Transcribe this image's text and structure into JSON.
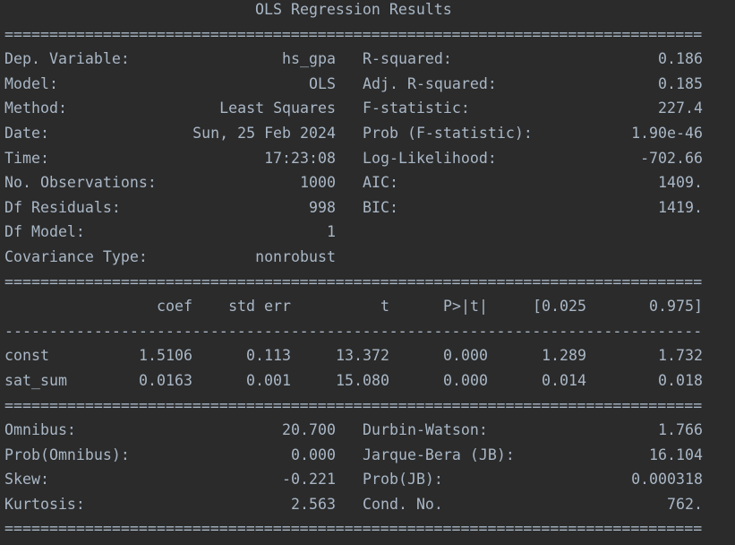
{
  "title": "OLS Regression Results",
  "sep_eq": "==============================================================================",
  "sep_dash": "------------------------------------------------------------------------------",
  "summary": [
    {
      "l_label": "Dep. Variable:",
      "l_value": "hs_gpa",
      "r_label": "R-squared:",
      "r_value": "0.186"
    },
    {
      "l_label": "Model:",
      "l_value": "OLS",
      "r_label": "Adj. R-squared:",
      "r_value": "0.185"
    },
    {
      "l_label": "Method:",
      "l_value": "Least Squares",
      "r_label": "F-statistic:",
      "r_value": "227.4"
    },
    {
      "l_label": "Date:",
      "l_value": "Sun, 25 Feb 2024",
      "r_label": "Prob (F-statistic):",
      "r_value": "1.90e-46"
    },
    {
      "l_label": "Time:",
      "l_value": "17:23:08",
      "r_label": "Log-Likelihood:",
      "r_value": "-702.66"
    },
    {
      "l_label": "No. Observations:",
      "l_value": "1000",
      "r_label": "AIC:",
      "r_value": "1409."
    },
    {
      "l_label": "Df Residuals:",
      "l_value": "998",
      "r_label": "BIC:",
      "r_value": "1419."
    },
    {
      "l_label": "Df Model:",
      "l_value": "1",
      "r_label": "",
      "r_value": ""
    },
    {
      "l_label": "Covariance Type:",
      "l_value": "nonrobust",
      "r_label": "",
      "r_value": ""
    }
  ],
  "coef_header": [
    "coef",
    "std err",
    "t",
    "P>|t|",
    "[0.025",
    "0.975]"
  ],
  "coef_rows": [
    {
      "name": "const",
      "coef": "1.5106",
      "std_err": "0.113",
      "t": "13.372",
      "p": "0.000",
      "lo": "1.289",
      "hi": "1.732"
    },
    {
      "name": "sat_sum",
      "coef": "0.0163",
      "std_err": "0.001",
      "t": "15.080",
      "p": "0.000",
      "lo": "0.014",
      "hi": "0.018"
    }
  ],
  "diagnostics": [
    {
      "l_label": "Omnibus:",
      "l_value": "20.700",
      "r_label": "Durbin-Watson:",
      "r_value": "1.766"
    },
    {
      "l_label": "Prob(Omnibus):",
      "l_value": "0.000",
      "r_label": "Jarque-Bera (JB):",
      "r_value": "16.104"
    },
    {
      "l_label": "Skew:",
      "l_value": "-0.221",
      "r_label": "Prob(JB):",
      "r_value": "0.000318"
    },
    {
      "l_label": "Kurtosis:",
      "l_value": "2.563",
      "r_label": "Cond. No.",
      "r_value": "762."
    }
  ]
}
